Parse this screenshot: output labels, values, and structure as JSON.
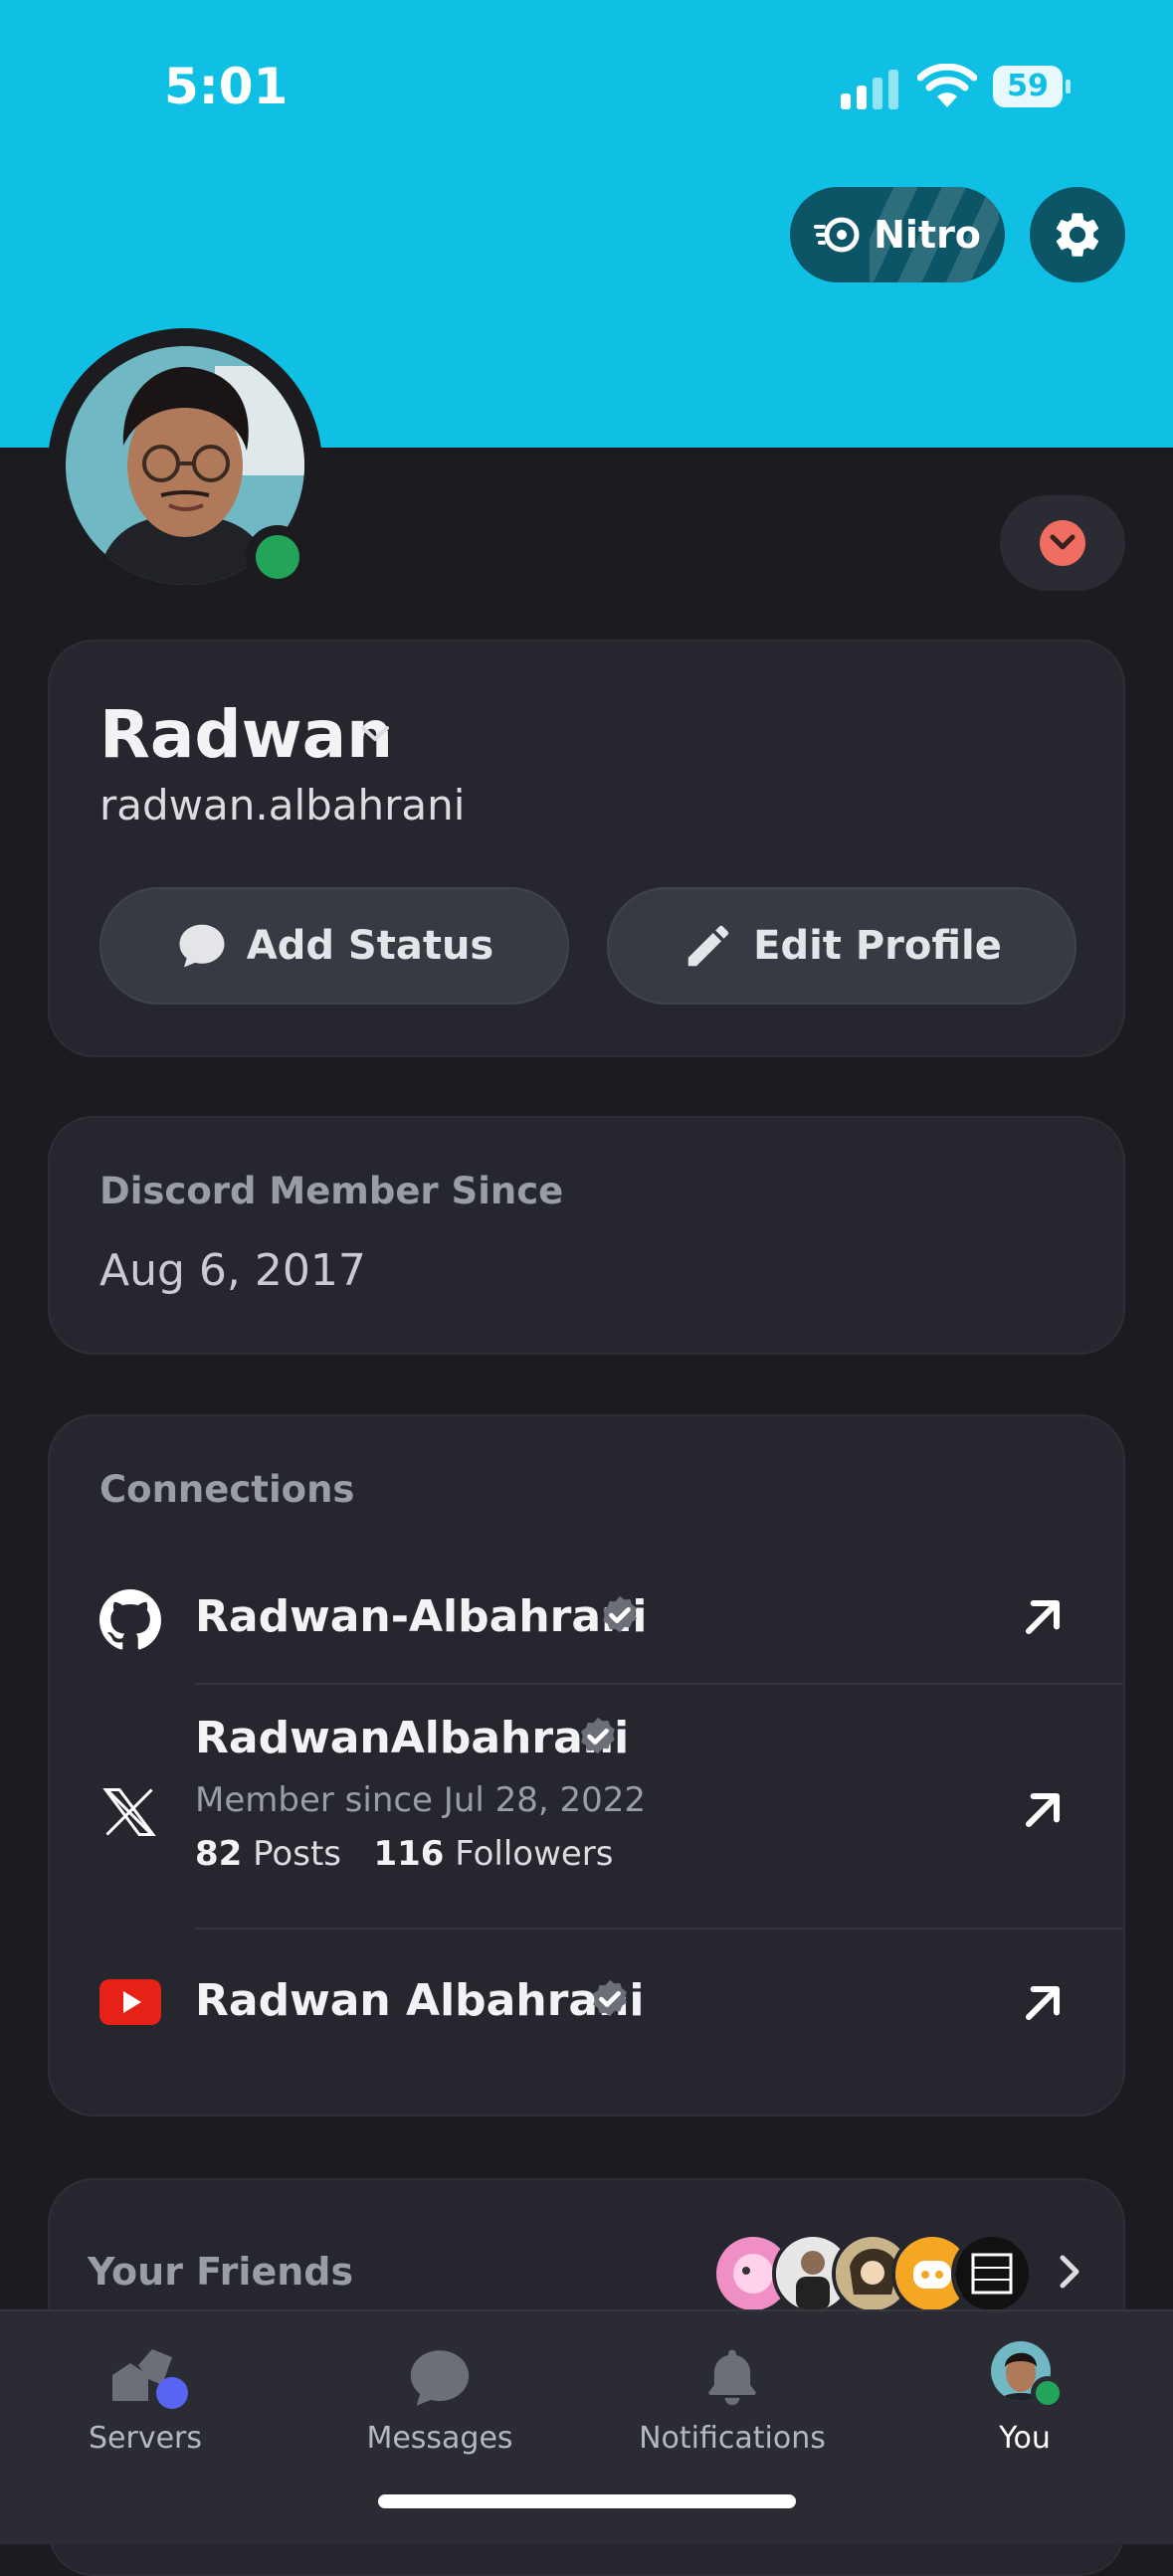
{
  "status_bar": {
    "time": "5:01",
    "battery": "59"
  },
  "header": {
    "nitro_label": "Nitro"
  },
  "profile": {
    "display_name": "Radwan",
    "username": "radwan.albahrani",
    "add_status_label": "Add Status",
    "edit_profile_label": "Edit Profile"
  },
  "member_since": {
    "title": "Discord Member Since",
    "date": "Aug 6, 2017"
  },
  "connections": {
    "title": "Connections",
    "items": [
      {
        "service": "github",
        "name": "Radwan-Albahrani"
      },
      {
        "service": "x",
        "name": "RadwanAlbahrani",
        "member_since": "Member since Jul 28, 2022",
        "posts_count": "82",
        "posts_label": "Posts",
        "followers_count": "116",
        "followers_label": "Followers"
      },
      {
        "service": "youtube",
        "name": "Radwan Albahrani"
      }
    ]
  },
  "friends": {
    "title": "Your Friends"
  },
  "tabbar": {
    "tabs": [
      {
        "label": "Servers"
      },
      {
        "label": "Messages"
      },
      {
        "label": "Notifications"
      },
      {
        "label": "You"
      }
    ]
  },
  "colors": {
    "banner": "#10c0e4",
    "online": "#23a559",
    "background": "#1c1c20",
    "card": "#26272e"
  },
  "icons": [
    "nitro-icon",
    "gear-icon",
    "chat-bubble-icon",
    "pencil-icon",
    "github-icon",
    "x-icon",
    "youtube-icon",
    "verified-icon",
    "external-arrow-icon",
    "servers-icon",
    "messages-icon",
    "bell-icon"
  ]
}
